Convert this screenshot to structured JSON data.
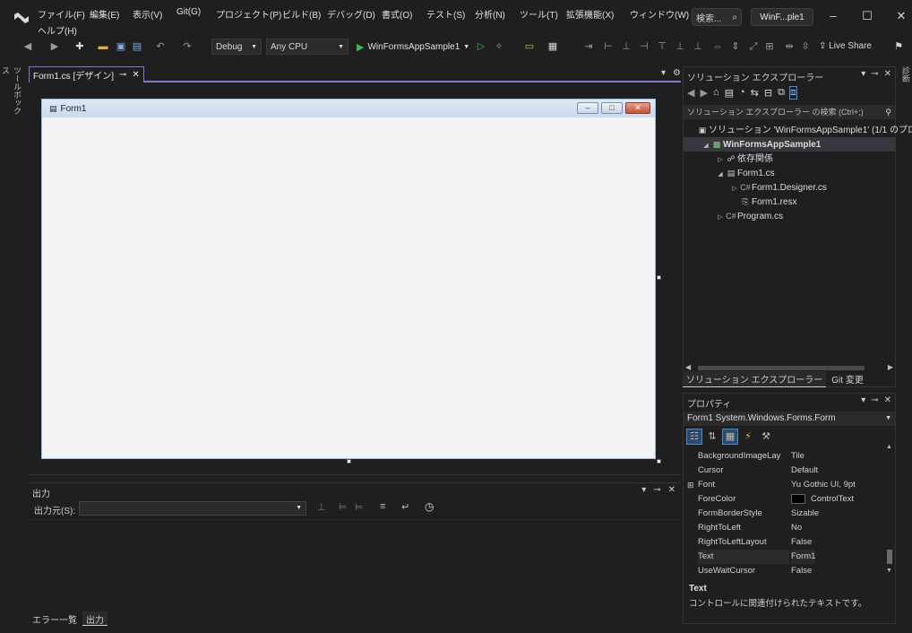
{
  "menu": {
    "items": [
      "ファイル(F)",
      "編集(E)",
      "表示(V)",
      "Git(G)",
      "プロジェクト(P)",
      "ビルド(B)",
      "デバッグ(D)",
      "書式(O)",
      "テスト(S)",
      "分析(N)",
      "ツール(T)",
      "拡張機能(X)",
      "ウィンドウ(W)",
      "ヘルプ(H)"
    ],
    "search_label": "検索...",
    "solution_label": "WinF...ple1"
  },
  "toolbar": {
    "config": "Debug",
    "platform": "Any CPU",
    "run_target": "WinFormsAppSample1",
    "live_share": "Live Share"
  },
  "side_strips": {
    "left": "ツールボックス",
    "right": "診断"
  },
  "designer": {
    "tab_label": "Form1.cs [デザイン]",
    "form_title": "Form1"
  },
  "output": {
    "title": "出力",
    "source_label": "出力元(S):",
    "bottom_tabs": [
      "エラー一覧",
      "出力"
    ]
  },
  "solution_explorer": {
    "title": "ソリューション エクスプローラー",
    "search_placeholder": "ソリューション エクスプローラー の検索 (Ctrl+;)",
    "tree": [
      {
        "label": "ソリューション 'WinFormsAppSample1' (1/1 のプロジェクト)",
        "icon": "solution-icon",
        "indent": 0,
        "expander": ""
      },
      {
        "label": "WinFormsAppSample1",
        "icon": "csharp-project-icon",
        "indent": 1,
        "expander": "◢"
      },
      {
        "label": "依存関係",
        "icon": "dependencies-icon",
        "indent": 2,
        "expander": "▷"
      },
      {
        "label": "Form1.cs",
        "icon": "form-file-icon",
        "indent": 2,
        "expander": "◢"
      },
      {
        "label": "Form1.Designer.cs",
        "icon": "csharp-file-icon",
        "indent": 3,
        "expander": "▷"
      },
      {
        "label": "Form1.resx",
        "icon": "resx-file-icon",
        "indent": 3,
        "expander": ""
      },
      {
        "label": "Program.cs",
        "icon": "csharp-file-icon",
        "indent": 2,
        "expander": "▷"
      }
    ],
    "tabs": [
      "ソリューション エクスプローラー",
      "Git 変更"
    ]
  },
  "properties": {
    "title": "プロパティ",
    "object": "Form1  System.Windows.Forms.Form",
    "rows": [
      {
        "name": "BackgroundImageLay",
        "value": "Tile"
      },
      {
        "name": "Cursor",
        "value": "Default"
      },
      {
        "name": "Font",
        "value": "Yu Gothic UI, 9pt",
        "expandable": true
      },
      {
        "name": "ForeColor",
        "value": "ControlText",
        "swatch": "#000000"
      },
      {
        "name": "FormBorderStyle",
        "value": "Sizable"
      },
      {
        "name": "RightToLeft",
        "value": "No"
      },
      {
        "name": "RightToLeftLayout",
        "value": "False"
      },
      {
        "name": "Text",
        "value": "Form1",
        "selected": true
      },
      {
        "name": "UseWaitCursor",
        "value": "False"
      }
    ],
    "desc_title": "Text",
    "desc_text": "コントロールに関連付けられたテキストです。"
  },
  "colors": {
    "accent": "#8575d6",
    "run_green": "#3fb54a",
    "background": "#1f1f1f"
  }
}
